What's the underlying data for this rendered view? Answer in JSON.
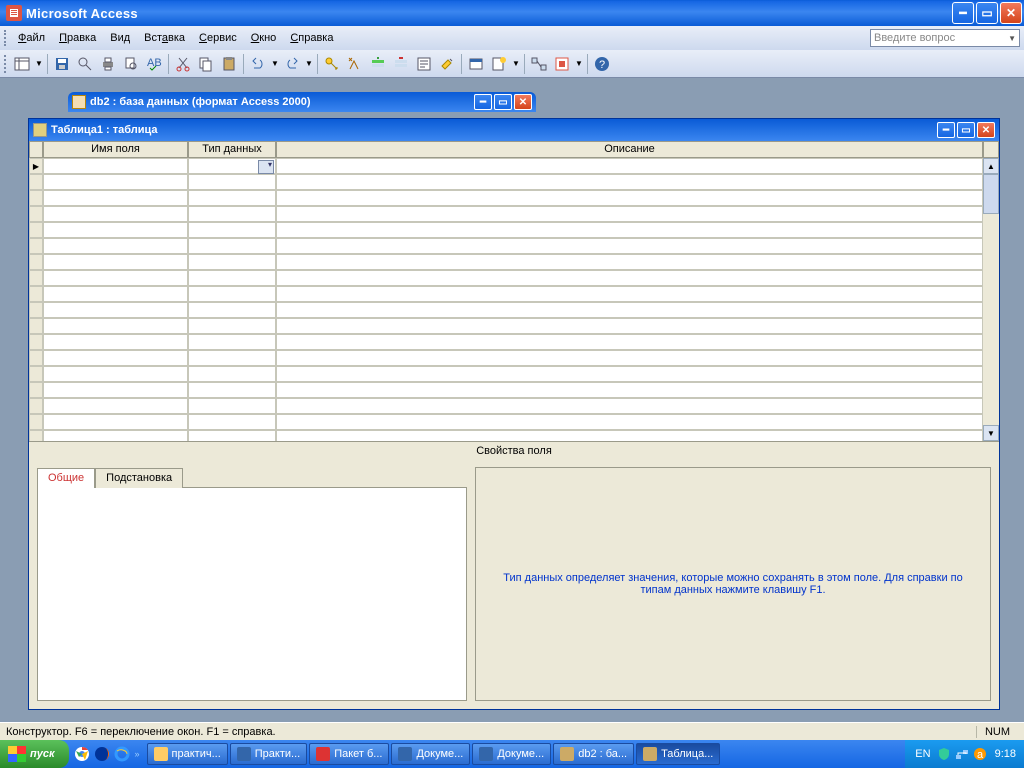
{
  "app": {
    "title": "Microsoft Access"
  },
  "menu": {
    "file": "Файл",
    "edit": "Правка",
    "view": "Вид",
    "insert": "Вставка",
    "service": "Сервис",
    "window": "Окно",
    "help": "Справка"
  },
  "askbox": {
    "placeholder": "Введите вопрос"
  },
  "dbwin": {
    "title": "db2 : база данных (формат Access 2000)"
  },
  "tablewin": {
    "title": "Таблица1 : таблица"
  },
  "grid_headers": {
    "fieldname": "Имя поля",
    "datatype": "Тип данных",
    "description": "Описание"
  },
  "fieldprops": {
    "section_label": "Свойства поля",
    "tab_general": "Общие",
    "tab_lookup": "Подстановка",
    "help_text": "Тип данных определяет значения, которые можно сохранять в этом поле.  Для справки по типам данных нажмите клавишу F1."
  },
  "statusbar": {
    "text": "Конструктор.  F6 = переключение окон.  F1 = справка.",
    "numlock": "NUM"
  },
  "taskbar": {
    "start": "пуск",
    "items": [
      {
        "label": "практич..."
      },
      {
        "label": "Практи..."
      },
      {
        "label": "Пакет б..."
      },
      {
        "label": "Докуме..."
      },
      {
        "label": "Докуме..."
      },
      {
        "label": "db2 : ба..."
      },
      {
        "label": "Таблица..."
      }
    ],
    "lang": "EN",
    "clock": "9:18"
  }
}
